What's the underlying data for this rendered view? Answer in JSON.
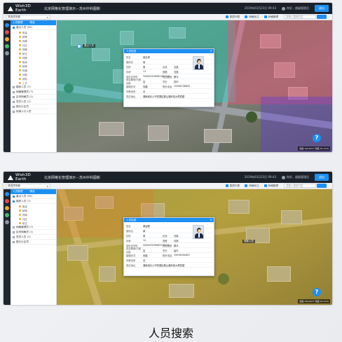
{
  "app": {
    "brand": "Wish3D Earth",
    "system_title": "北京网格化管理演示－苏州中科图新",
    "datetime": "2019年03月23日 09:43",
    "user": "admin",
    "welcome": "你好，超级管理员",
    "exit_label": "退出"
  },
  "toolbar": {
    "scene_select": "请选择场景",
    "tools": [
      "图层列表",
      "网格标注",
      "网格管理"
    ],
    "search_placeholder": "请输入搜索内容"
  },
  "sidebar_one": {
    "tabs": [
      "人员管理",
      "筛选"
    ],
    "groups": [
      {
        "label": "重点人员 (39)",
        "checked": true,
        "sub": [
          "吸毒",
          "精神",
          "刑释",
          "社区",
          "邪教",
          "矫正",
          "特殊",
          "吸毒",
          "精神",
          "刑满",
          "涉稳",
          "其他",
          "上访"
        ]
      },
      {
        "label": "楼栋人员 (7)",
        "checked": false,
        "sub": []
      },
      {
        "label": "网格管理员 (7)",
        "checked": false,
        "sub": []
      },
      {
        "label": "区块网格员 (1)",
        "checked": false,
        "sub": []
      },
      {
        "label": "党员人员 (1)",
        "checked": false,
        "sub": []
      },
      {
        "label": "楼长片区员",
        "checked": false,
        "sub": []
      },
      {
        "label": "特殊人口人员",
        "checked": false,
        "sub": []
      }
    ]
  },
  "sidebar_two": {
    "tabs": [
      "人员管理",
      "筛选"
    ],
    "groups": [
      {
        "label": "重点人员 (39)",
        "checked": true,
        "sub": []
      },
      {
        "label": "楼栋人员 (7)",
        "checked": true,
        "sub": [
          "吸毒",
          "精神",
          "刑释",
          "社区",
          "矫正"
        ]
      },
      {
        "label": "网格管理员 (7)",
        "checked": false,
        "sub": []
      },
      {
        "label": "区块网格员 (1)",
        "checked": false,
        "sub": []
      },
      {
        "label": "党员人员 (1)",
        "checked": false,
        "sub": []
      },
      {
        "label": "楼长片区员",
        "checked": false,
        "sub": []
      }
    ]
  },
  "popup_one": {
    "title": "人员信息",
    "close": "×",
    "rows": [
      {
        "label": "姓名",
        "value": "吴无事",
        "label2": "",
        "value2": ""
      },
      {
        "label": "曾用名",
        "value": "曼",
        "label2": "",
        "value2": ""
      },
      {
        "label": "性别",
        "value": "男",
        "label2": "民族",
        "value2": "汉族"
      },
      {
        "label": "年龄",
        "value": "11",
        "label2": "国籍",
        "value2": "汉族"
      },
      {
        "label": "身份证号码",
        "value": "320503199902181719",
        "label2": "政治面貌",
        "value2": "群众"
      },
      {
        "label": "是否服役/已服兵役",
        "value": "否",
        "label2": "学历",
        "value2": "初中"
      },
      {
        "label": "婚姻状况",
        "value": "未婚",
        "label2": "联系电话",
        "value2": "15356758832"
      },
      {
        "label": "宗教信仰",
        "value": "无",
        "label2": "",
        "value2": ""
      }
    ],
    "address_label": "现住地址",
    "address": "湖南省长沙市岳麓区麓山路科技大厦四楼"
  },
  "popup_two": {
    "title": "人员信息",
    "close": "×",
    "rows": [
      {
        "label": "姓名",
        "value": "郭运照",
        "label2": "",
        "value2": ""
      },
      {
        "label": "曾用名",
        "value": "郭",
        "label2": "",
        "value2": ""
      },
      {
        "label": "性别",
        "value": "男",
        "label2": "民族",
        "value2": "汉族"
      },
      {
        "label": "年龄",
        "value": "12",
        "label2": "国籍",
        "value2": "汉族"
      },
      {
        "label": "身份证号码",
        "value": "320503199903170271",
        "label2": "政治面貌",
        "value2": "群众"
      },
      {
        "label": "是否服役/已服兵役",
        "value": "否",
        "label2": "学历",
        "value2": "高中"
      },
      {
        "label": "婚姻状况",
        "value": "未婚",
        "label2": "联系电话",
        "value2": "15976592657"
      },
      {
        "label": "宗教信仰",
        "value": "无",
        "label2": "",
        "value2": ""
      }
    ],
    "address_label": "现住地址",
    "address": "湖南省长沙市岳麓区麓山路科技大厦四楼"
  },
  "map_one": {
    "marker_label": "1",
    "marker_text": "重点人员"
  },
  "map_two": {
    "marker_text": "楼栋人员"
  },
  "coords": "经度:120.6277 纬度:31.3170",
  "help": "?",
  "caption": "人员搜索"
}
